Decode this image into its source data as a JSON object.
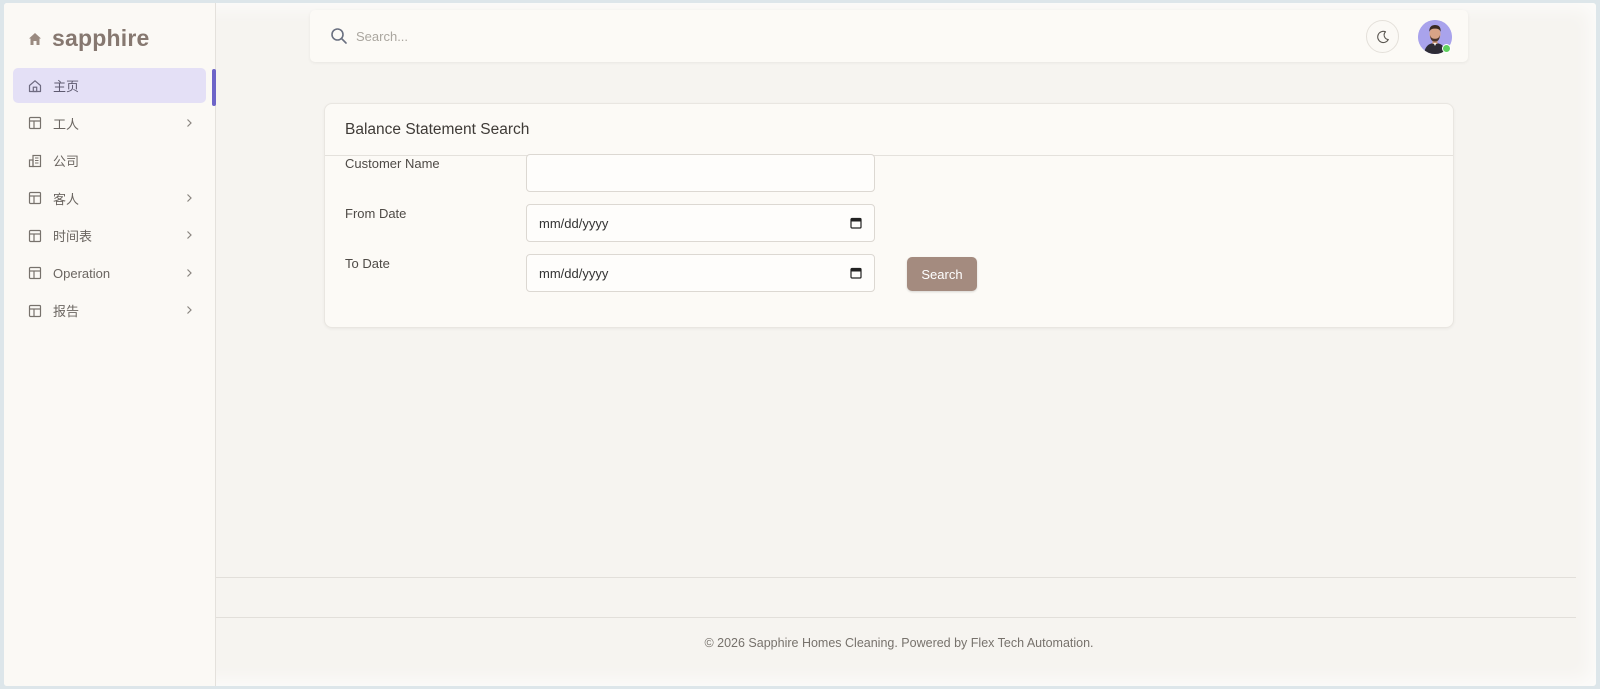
{
  "brand": {
    "name": "sapphire",
    "icon": "home-icon"
  },
  "sidebar": {
    "items": [
      {
        "label": "主页",
        "icon": "home-outline-icon",
        "active": true,
        "has_children": false
      },
      {
        "label": "工人",
        "icon": "layout-icon",
        "active": false,
        "has_children": true
      },
      {
        "label": "公司",
        "icon": "building-icon",
        "active": false,
        "has_children": false
      },
      {
        "label": "客人",
        "icon": "layout-icon",
        "active": false,
        "has_children": true
      },
      {
        "label": "时间表",
        "icon": "layout-icon",
        "active": false,
        "has_children": true
      },
      {
        "label": "Operation",
        "icon": "layout-icon",
        "active": false,
        "has_children": true
      },
      {
        "label": "报告",
        "icon": "layout-icon",
        "active": false,
        "has_children": true
      }
    ]
  },
  "topbar": {
    "search_placeholder": "Search...",
    "search_value": "",
    "theme_icon": "moon-icon",
    "avatar_status": "online"
  },
  "form": {
    "title": "Balance Statement Search",
    "customer_name_label": "Customer Name",
    "customer_name_value": "",
    "from_date_label": "From Date",
    "from_date_value": "mm/dd/yyyy",
    "to_date_label": "To Date",
    "to_date_value": "mm/dd/yyyy",
    "search_button": "Search"
  },
  "footer": {
    "text": "© 2026 Sapphire Homes Cleaning. Powered by Flex Tech Automation."
  },
  "colors": {
    "brand": "#867870",
    "accent": "#6d64c8",
    "active_bg": "#e4e0f6",
    "button": "#a48b7f",
    "online": "#5fd05f"
  }
}
